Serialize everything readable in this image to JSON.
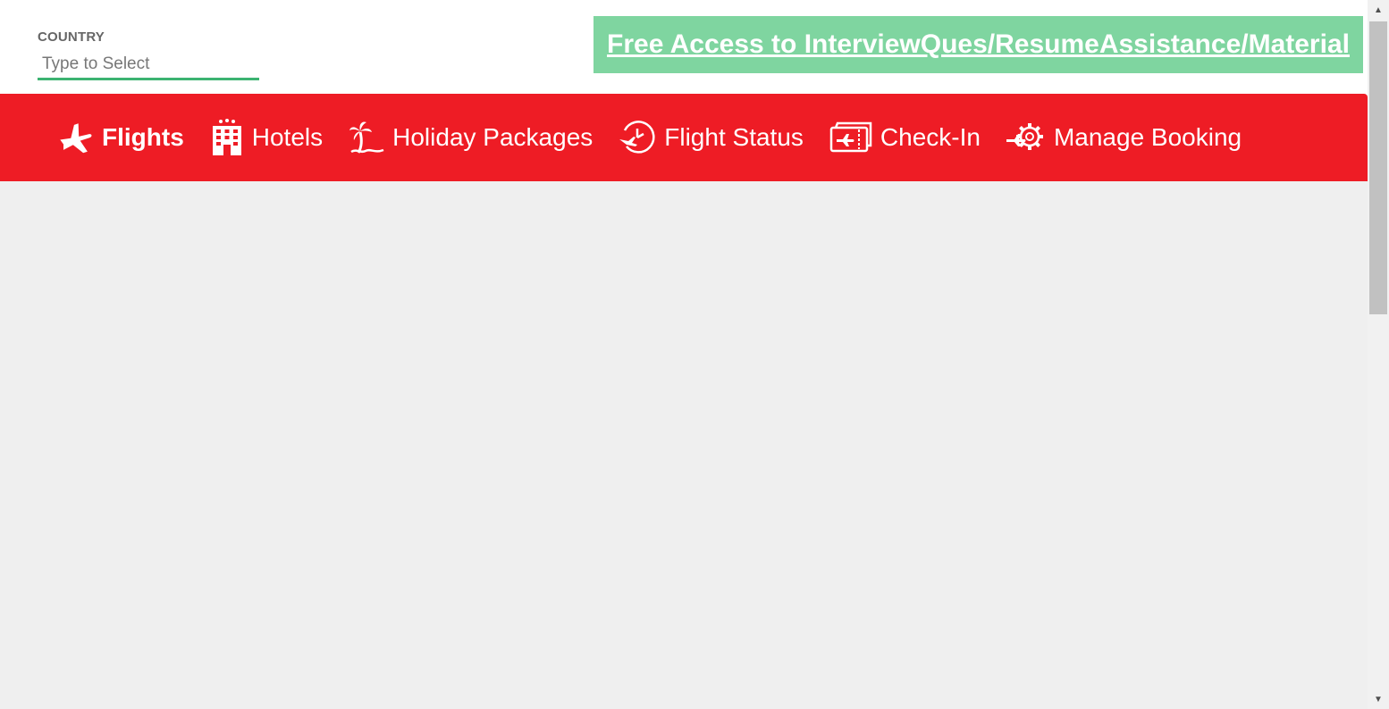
{
  "country": {
    "label": "COUNTRY",
    "placeholder": "Type to Select",
    "value": ""
  },
  "promo": {
    "link_text": "Free Access to InterviewQues/ResumeAssistance/Material",
    "background_color": "#7fd5a0"
  },
  "nav": {
    "background_color": "#ee1c25",
    "items": [
      {
        "label": "Flights",
        "icon": "airplane-icon",
        "active": true
      },
      {
        "label": "Hotels",
        "icon": "hotel-building-icon",
        "active": false
      },
      {
        "label": "Holiday Packages",
        "icon": "palm-tree-icon",
        "active": false
      },
      {
        "label": "Flight Status",
        "icon": "clock-plane-icon",
        "active": false
      },
      {
        "label": "Check-In",
        "icon": "boarding-pass-icon",
        "active": false
      },
      {
        "label": "Manage Booking",
        "icon": "gear-plane-icon",
        "active": false
      }
    ]
  },
  "colors": {
    "accent_green": "#3cb371",
    "content_bg": "#efefef"
  }
}
